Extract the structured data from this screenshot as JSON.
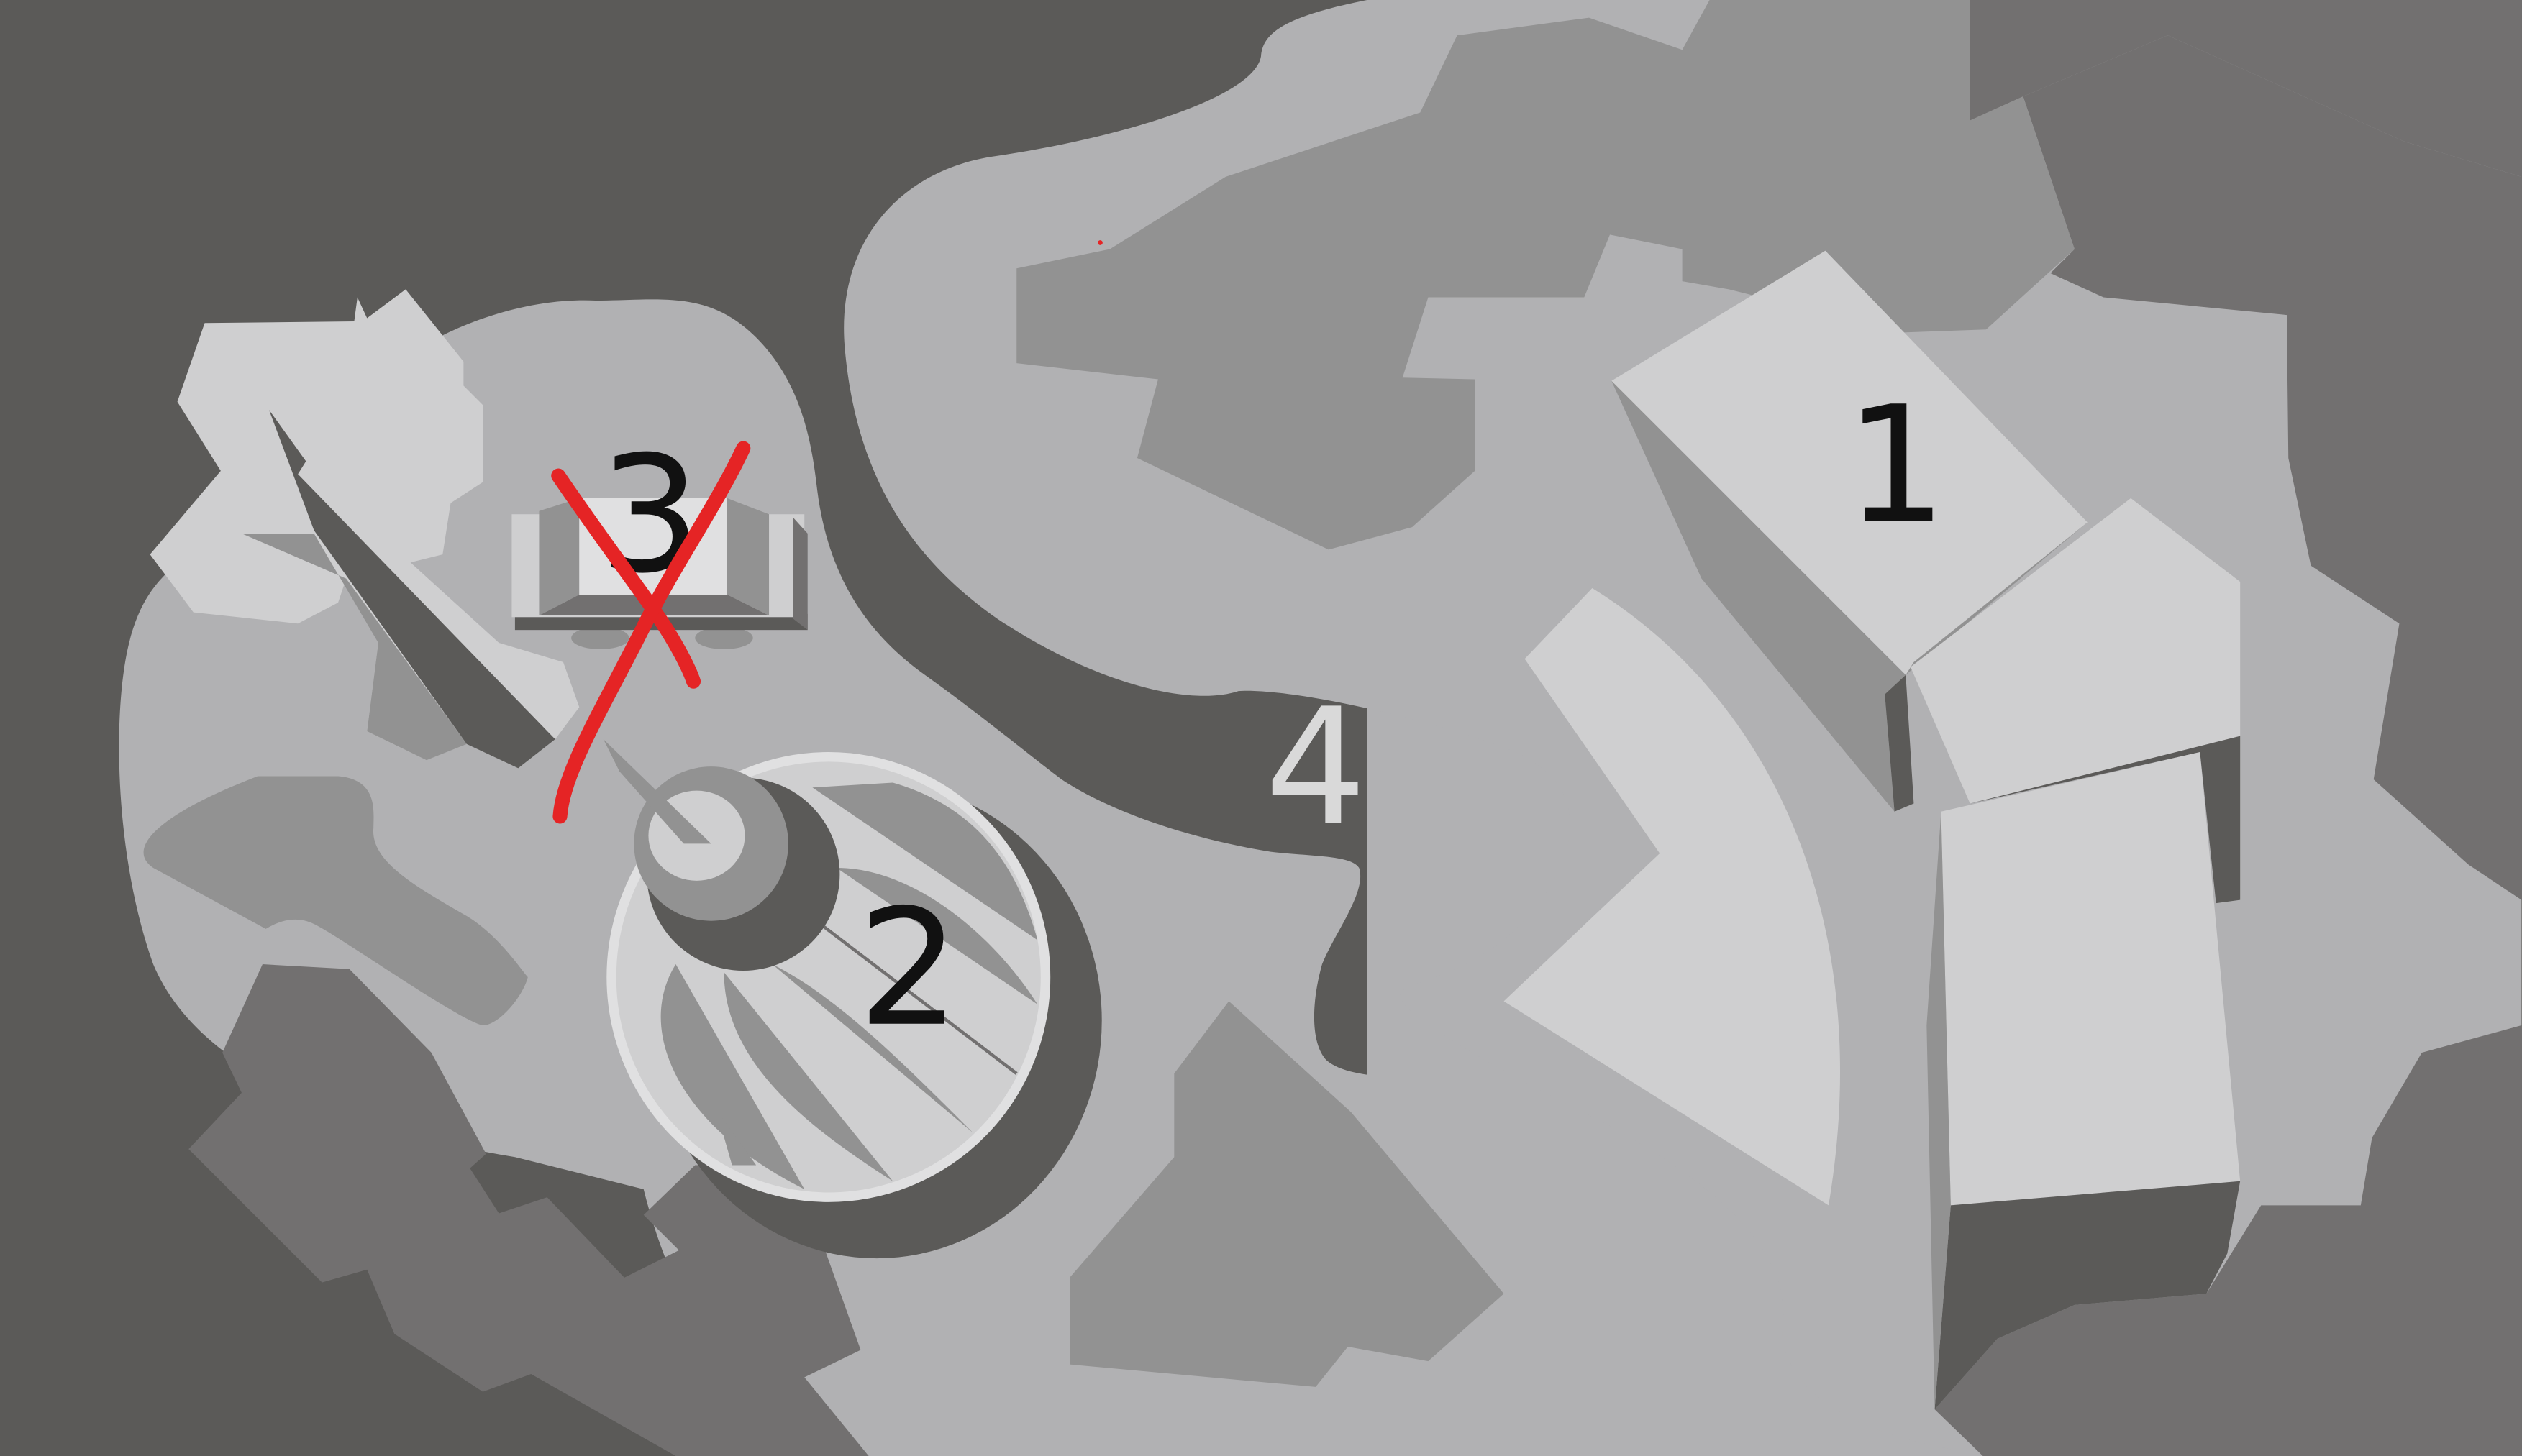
{
  "map": {
    "colors": {
      "background": "#5b5a58",
      "open_ground": "#b1b1b3",
      "rock_dark": "#727070",
      "rock_medium": "#929292",
      "structure_light": "#cfcfd0",
      "structure_mid": "#8f8f8f",
      "shadow": "#5b5a58",
      "highlight": "#e0e0e1",
      "cross_mark": "#e52425"
    },
    "markers": [
      {
        "id": "1",
        "label": "1",
        "color": "#111111"
      },
      {
        "id": "2",
        "label": "2",
        "color": "#111111"
      },
      {
        "id": "3",
        "label": "3",
        "color": "#111111",
        "crossed_out": true
      },
      {
        "id": "4",
        "label": "4",
        "color": "#d9d9d9"
      }
    ],
    "cross_icon": "x-mark-icon"
  }
}
